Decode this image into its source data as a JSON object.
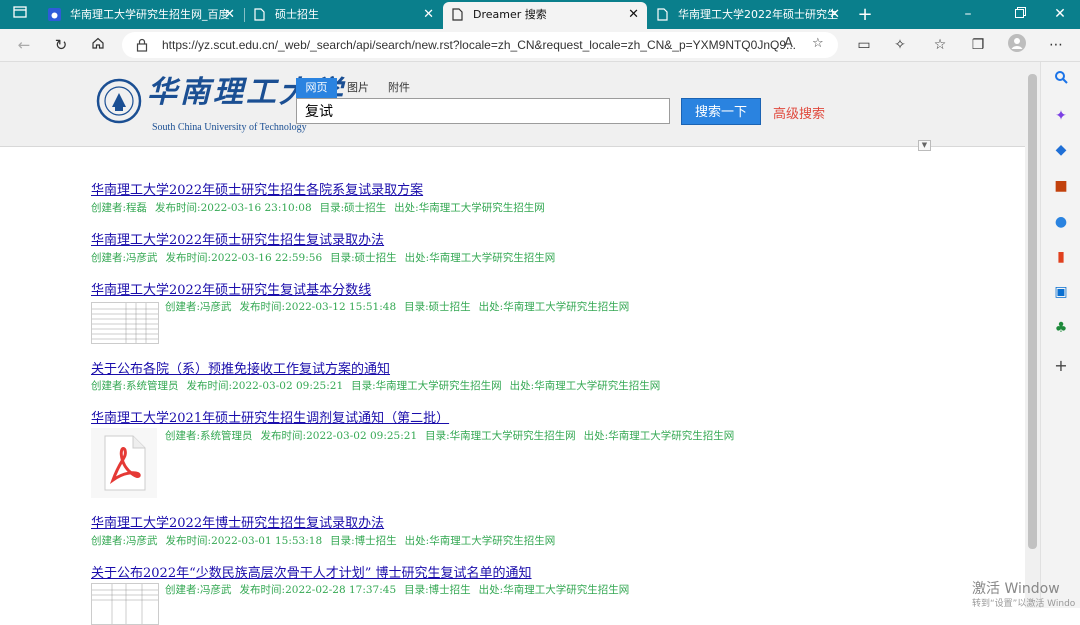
{
  "browser": {
    "tabs": [
      {
        "label": "华南理工大学研究生招生网_百度",
        "active": false
      },
      {
        "label": "硕士招生",
        "active": false
      },
      {
        "label": "Dreamer 搜索",
        "active": true
      },
      {
        "label": "华南理工大学2022年硕士研究生",
        "active": false
      }
    ],
    "url": "https://yz.scut.edu.cn/_web/_search/api/search/new.rst?locale=zh_CN&request_locale=zh_CN&_p=YXM9NTQ0JnQ9...",
    "colors": {
      "tabbar": "#0a7f8c",
      "toolbar": "#f3f3f3"
    }
  },
  "site": {
    "logo_cn": "华南理工大学",
    "logo_en": "South China University of Technology"
  },
  "search": {
    "tabs": [
      "网页",
      "图片",
      "附件"
    ],
    "query": "复试",
    "button_label": "搜索一下",
    "advanced_label": "高级搜索",
    "accent": "#2a83e0"
  },
  "results": [
    {
      "title": "华南理工大学2022年硕士研究生招生各院系复试录取方案",
      "creator": "创建者:程磊",
      "time": "发布时间:2022-03-16 23:10:08",
      "dir": "目录:硕士招生",
      "source": "出处:华南理工大学研究生招生网"
    },
    {
      "title": "华南理工大学2022年硕士研究生招生复试录取办法",
      "creator": "创建者:冯彦武",
      "time": "发布时间:2022-03-16 22:59:56",
      "dir": "目录:硕士招生",
      "source": "出处:华南理工大学研究生招生网"
    },
    {
      "title": "华南理工大学2022年硕士研究生复试基本分数线",
      "creator": "创建者:冯彦武",
      "time": "发布时间:2022-03-12 15:51:48",
      "dir": "目录:硕士招生",
      "source": "出处:华南理工大学研究生招生网"
    },
    {
      "title": "关于公布各院（系）预推免接收工作复试方案的通知",
      "creator": "创建者:系统管理员",
      "time": "发布时间:2022-03-02 09:25:21",
      "dir": "目录:华南理工大学研究生招生网",
      "source": "出处:华南理工大学研究生招生网"
    },
    {
      "title": "华南理工大学2021年硕士研究生招生调剂复试通知（第二批）",
      "creator": "创建者:系统管理员",
      "time": "发布时间:2022-03-02 09:25:21",
      "dir": "目录:华南理工大学研究生招生网",
      "source": "出处:华南理工大学研究生招生网"
    },
    {
      "title": "华南理工大学2022年博士研究生招生复试录取办法",
      "creator": "创建者:冯彦武",
      "time": "发布时间:2022-03-01 15:53:18",
      "dir": "目录:博士招生",
      "source": "出处:华南理工大学研究生招生网"
    },
    {
      "title": "关于公布2022年“少数民族高层次骨干人才计划” 博士研究生复试名单的通知",
      "creator": "创建者:冯彦武",
      "time": "发布时间:2022-02-28 17:37:45",
      "dir": "目录:博士招生",
      "source": "出处:华南理工大学研究生招生网"
    }
  ],
  "watermark": {
    "line1": "激活 Window",
    "line2": "转到“设置”以激活 Windo"
  }
}
